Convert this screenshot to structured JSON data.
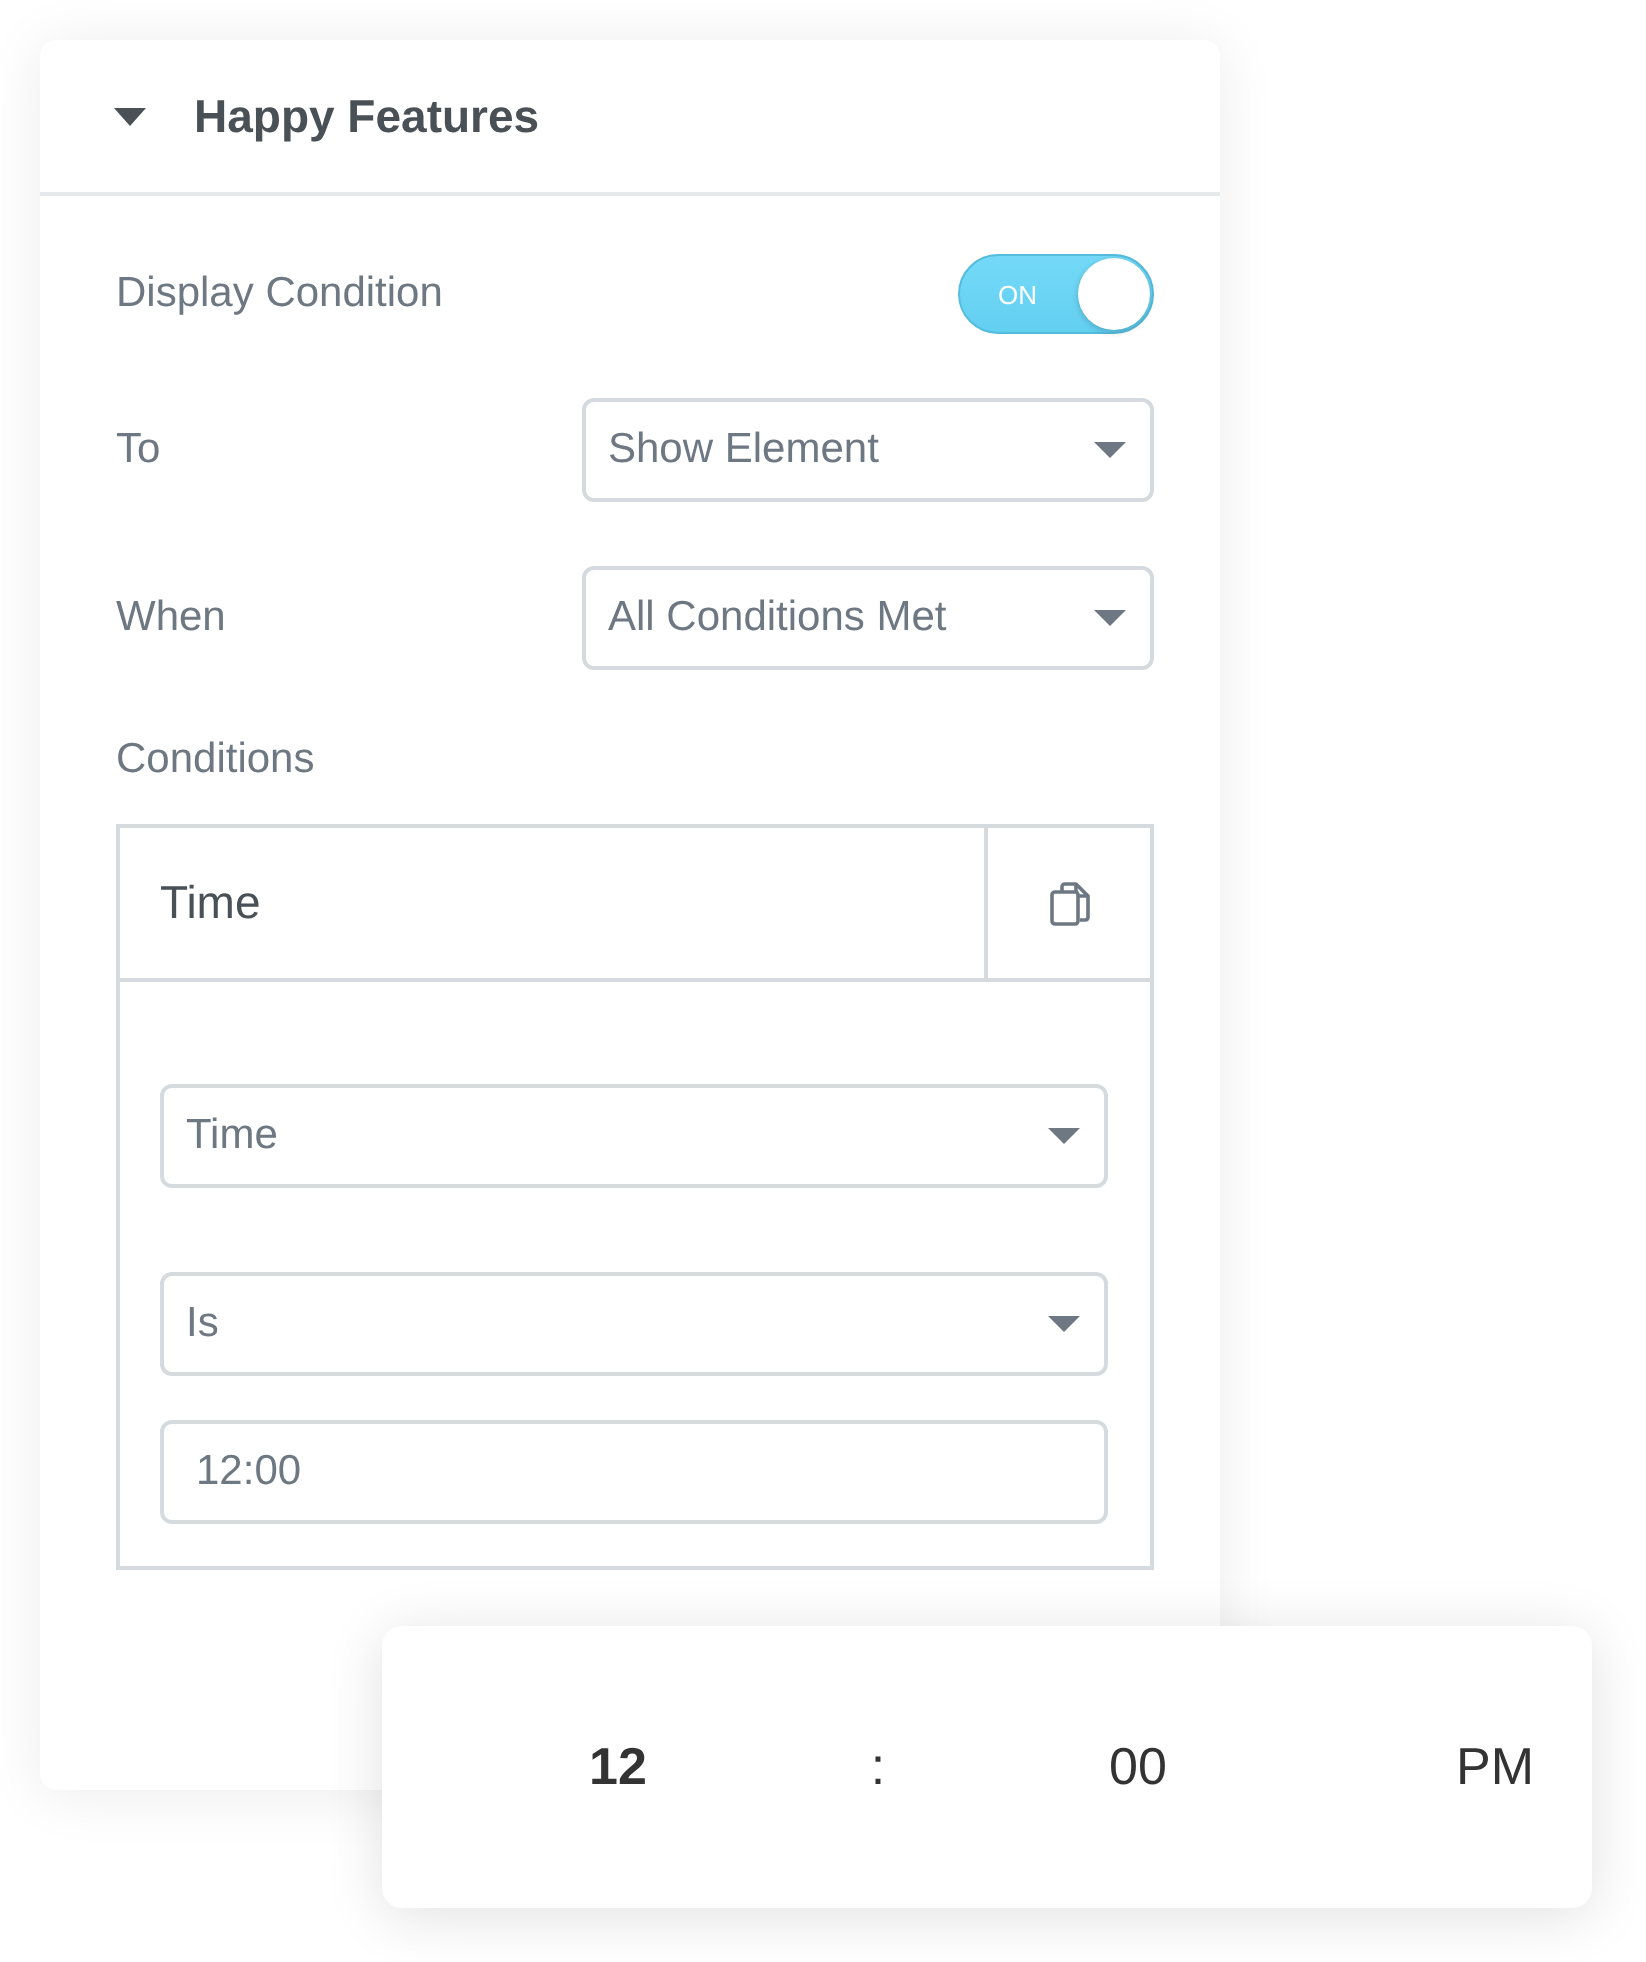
{
  "panel": {
    "title": "Happy Features",
    "expanded": true
  },
  "controls": [
    {
      "kind": "toggle",
      "label": "Display Condition",
      "on": true,
      "state_text": "ON"
    },
    {
      "kind": "select",
      "label": "To",
      "value": "Show Element"
    },
    {
      "kind": "select",
      "label": "When",
      "value": "All Conditions Met"
    }
  ],
  "conditions": {
    "label": "Conditions",
    "items": [
      {
        "title": "Time",
        "expanded": true,
        "fields": [
          {
            "kind": "select",
            "value": "Time"
          },
          {
            "kind": "select",
            "value": "Is"
          },
          {
            "kind": "input",
            "value": "12:00"
          }
        ]
      }
    ]
  },
  "time_picker": {
    "segments": [
      {
        "kind": "value",
        "text": "12",
        "selected": true
      },
      {
        "kind": "separator",
        "text": ":"
      },
      {
        "kind": "value",
        "text": "00",
        "selected": false
      },
      {
        "kind": "value",
        "text": "PM",
        "selected": false
      }
    ]
  }
}
